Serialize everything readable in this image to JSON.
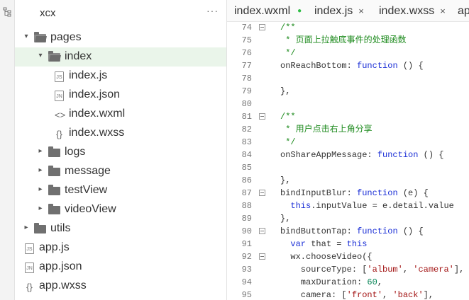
{
  "explorer": {
    "project_name": "xcx",
    "more_label": "···",
    "tree": [
      {
        "type": "folder",
        "label": "pages",
        "expanded": true,
        "depth": 0
      },
      {
        "type": "folder",
        "label": "index",
        "expanded": true,
        "depth": 1,
        "selected": true
      },
      {
        "type": "file",
        "label": "index.js",
        "icon": "js-file-icon",
        "badge": "JS",
        "depth": 2
      },
      {
        "type": "file",
        "label": "index.json",
        "icon": "json-file-icon",
        "badge": "JN",
        "depth": 2
      },
      {
        "type": "file",
        "label": "index.wxml",
        "icon": "wxml-file-icon",
        "badge": "<>",
        "depth": 2
      },
      {
        "type": "file",
        "label": "index.wxss",
        "icon": "wxss-file-icon",
        "badge": "{}",
        "depth": 2
      },
      {
        "type": "folder",
        "label": "logs",
        "expanded": false,
        "depth": 1
      },
      {
        "type": "folder",
        "label": "message",
        "expanded": false,
        "depth": 1
      },
      {
        "type": "folder",
        "label": "testView",
        "expanded": false,
        "depth": 1
      },
      {
        "type": "folder",
        "label": "videoView",
        "expanded": false,
        "depth": 1
      },
      {
        "type": "folder",
        "label": "utils",
        "expanded": false,
        "depth": 0
      },
      {
        "type": "file",
        "label": "app.js",
        "icon": "js-file-icon",
        "badge": "JS",
        "depth": 0
      },
      {
        "type": "file",
        "label": "app.json",
        "icon": "json-file-icon",
        "badge": "JN",
        "depth": 0
      },
      {
        "type": "file",
        "label": "app.wxss",
        "icon": "wxss-file-icon",
        "badge": "{}",
        "depth": 0
      }
    ]
  },
  "tabs": [
    {
      "label": "index.wxml",
      "modified": true,
      "dot": "●"
    },
    {
      "label": "index.js",
      "close": "×"
    },
    {
      "label": "index.wxss",
      "close": "×"
    },
    {
      "label": "ap"
    }
  ],
  "code": [
    {
      "n": "74",
      "fold": true,
      "parts": [
        {
          "t": "/**",
          "c": "comment"
        }
      ]
    },
    {
      "n": "75",
      "parts": [
        {
          "t": " * 页面上拉触底事件的处理函数",
          "c": "comment"
        }
      ]
    },
    {
      "n": "76",
      "parts": [
        {
          "t": " */",
          "c": "comment"
        }
      ]
    },
    {
      "n": "77",
      "parts": [
        {
          "t": "onReachBottom: ",
          "c": ""
        },
        {
          "t": "function",
          "c": "kw"
        },
        {
          "t": " () {",
          "c": ""
        }
      ]
    },
    {
      "n": "78",
      "parts": []
    },
    {
      "n": "79",
      "parts": [
        {
          "t": "},",
          "c": ""
        }
      ]
    },
    {
      "n": "80",
      "parts": []
    },
    {
      "n": "81",
      "fold": true,
      "parts": [
        {
          "t": "/**",
          "c": "comment"
        }
      ]
    },
    {
      "n": "82",
      "parts": [
        {
          "t": " * 用户点击右上角分享",
          "c": "comment"
        }
      ]
    },
    {
      "n": "83",
      "parts": [
        {
          "t": " */",
          "c": "comment"
        }
      ]
    },
    {
      "n": "84",
      "parts": [
        {
          "t": "onShareAppMessage: ",
          "c": ""
        },
        {
          "t": "function",
          "c": "kw"
        },
        {
          "t": " () {",
          "c": ""
        }
      ]
    },
    {
      "n": "85",
      "parts": []
    },
    {
      "n": "86",
      "parts": [
        {
          "t": "},",
          "c": ""
        }
      ]
    },
    {
      "n": "87",
      "fold": true,
      "parts": [
        {
          "t": "bindInputBlur: ",
          "c": ""
        },
        {
          "t": "function",
          "c": "kw"
        },
        {
          "t": " (e) {",
          "c": ""
        }
      ]
    },
    {
      "n": "88",
      "parts": [
        {
          "t": "  ",
          "c": ""
        },
        {
          "t": "this",
          "c": "kw"
        },
        {
          "t": ".inputValue = e.detail.value",
          "c": ""
        }
      ]
    },
    {
      "n": "89",
      "parts": [
        {
          "t": "},",
          "c": ""
        }
      ]
    },
    {
      "n": "90",
      "fold": true,
      "parts": [
        {
          "t": "bindButtonTap: ",
          "c": ""
        },
        {
          "t": "function",
          "c": "kw"
        },
        {
          "t": " () {",
          "c": ""
        }
      ]
    },
    {
      "n": "91",
      "parts": [
        {
          "t": "  ",
          "c": ""
        },
        {
          "t": "var",
          "c": "kw"
        },
        {
          "t": " that = ",
          "c": ""
        },
        {
          "t": "this",
          "c": "kw"
        }
      ]
    },
    {
      "n": "92",
      "fold": true,
      "parts": [
        {
          "t": "  wx.chooseVideo({",
          "c": ""
        }
      ]
    },
    {
      "n": "93",
      "parts": [
        {
          "t": "    sourceType: [",
          "c": ""
        },
        {
          "t": "'album'",
          "c": "str"
        },
        {
          "t": ", ",
          "c": ""
        },
        {
          "t": "'camera'",
          "c": "str"
        },
        {
          "t": "],",
          "c": ""
        }
      ]
    },
    {
      "n": "94",
      "parts": [
        {
          "t": "    maxDuration: ",
          "c": ""
        },
        {
          "t": "60",
          "c": "num"
        },
        {
          "t": ",",
          "c": ""
        }
      ]
    },
    {
      "n": "95",
      "parts": [
        {
          "t": "    camera: [",
          "c": ""
        },
        {
          "t": "'front'",
          "c": "str"
        },
        {
          "t": ", ",
          "c": ""
        },
        {
          "t": "'back'",
          "c": "str"
        },
        {
          "t": "],",
          "c": ""
        }
      ]
    }
  ]
}
